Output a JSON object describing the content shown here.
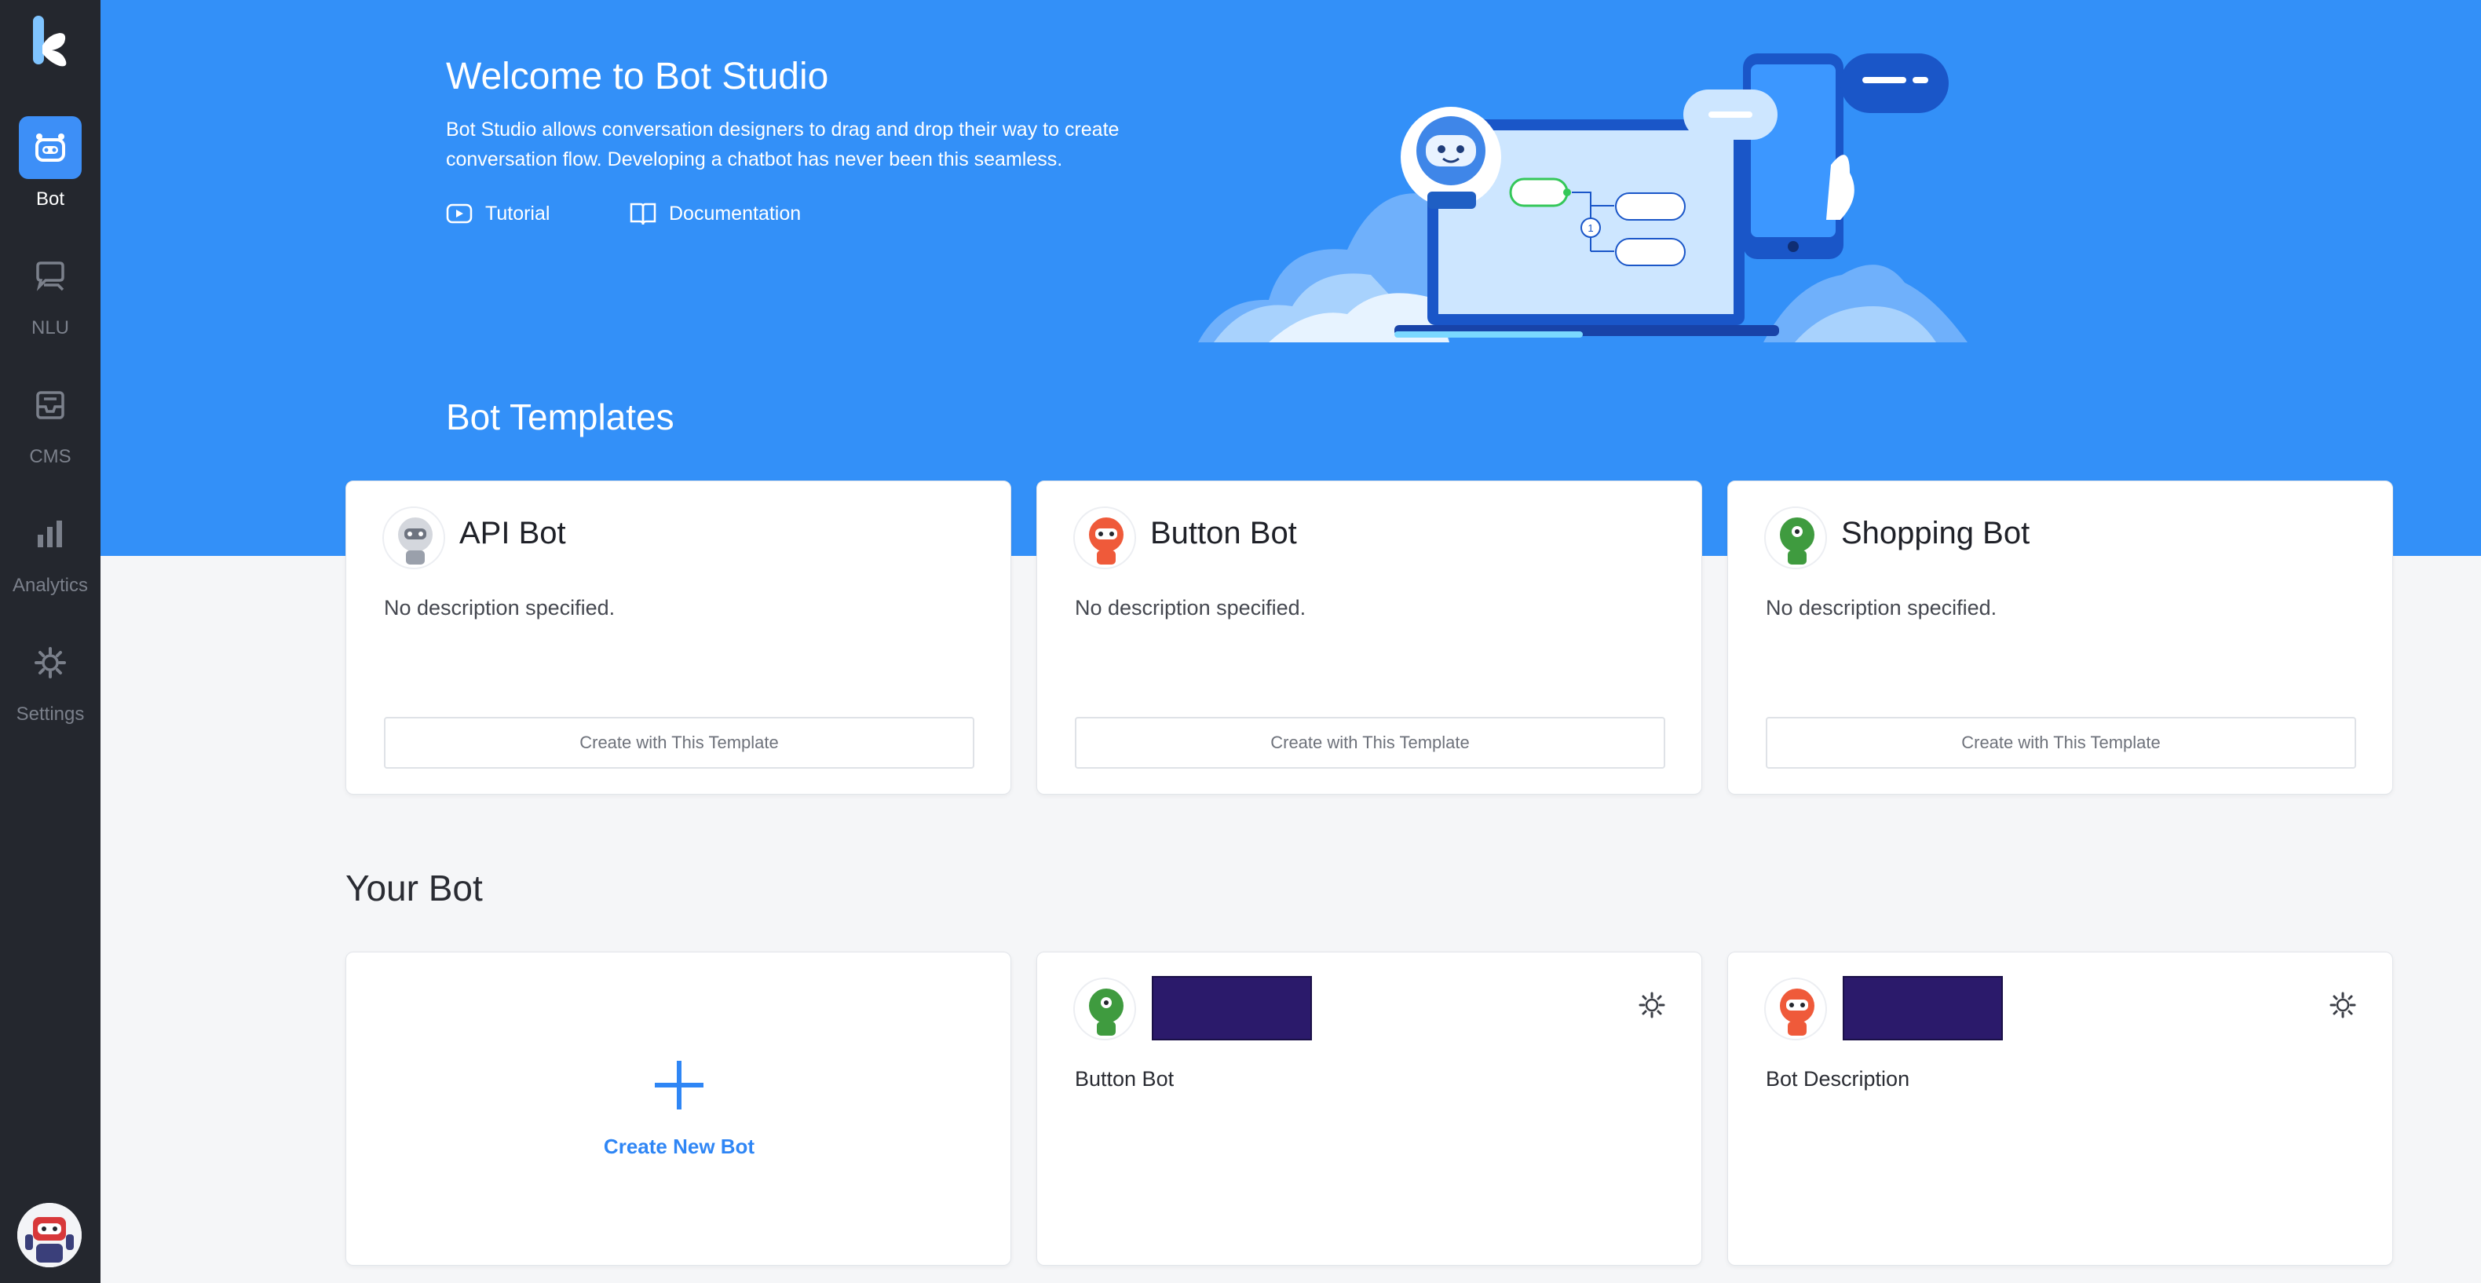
{
  "sidebar": {
    "items": [
      {
        "label": "Bot",
        "icon": "robot-icon",
        "active": true
      },
      {
        "label": "NLU",
        "icon": "chat-icon",
        "active": false
      },
      {
        "label": "CMS",
        "icon": "inbox-icon",
        "active": false
      },
      {
        "label": "Analytics",
        "icon": "bar-chart-icon",
        "active": false
      },
      {
        "label": "Settings",
        "icon": "gear-icon",
        "active": false
      }
    ]
  },
  "hero": {
    "title": "Welcome to Bot Studio",
    "description": "Bot Studio allows conversation designers to drag and drop their way to create conversation flow. Developing a chatbot has never been this seamless.",
    "links": {
      "tutorial": "Tutorial",
      "documentation": "Documentation"
    }
  },
  "templates": {
    "heading": "Bot Templates",
    "cards": [
      {
        "title": "API Bot",
        "description": "No description specified.",
        "button": "Create with This Template"
      },
      {
        "title": "Button Bot",
        "description": "No description specified.",
        "button": "Create with This Template"
      },
      {
        "title": "Shopping Bot",
        "description": "No description specified.",
        "button": "Create with This Template"
      }
    ]
  },
  "your_bot": {
    "heading": "Your Bot",
    "create_label": "Create New Bot",
    "bots": [
      {
        "subtitle": "Button Bot"
      },
      {
        "subtitle": "Bot Description"
      }
    ]
  },
  "colors": {
    "accent": "#3390f8",
    "sidebar": "#24272e",
    "redacted_name": "#2b1a6b"
  }
}
